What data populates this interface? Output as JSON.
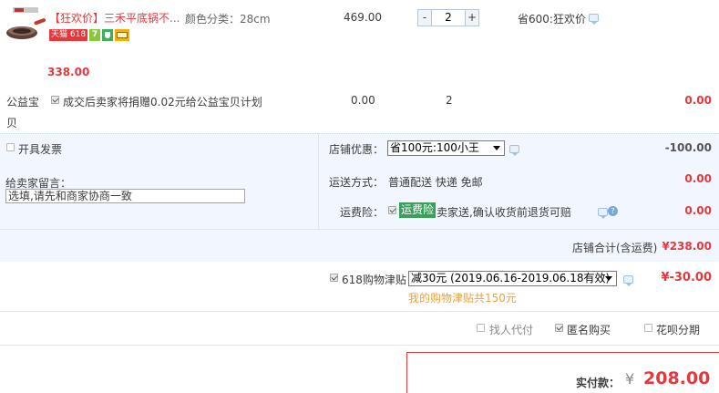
{
  "item": {
    "title_tag": "【狂欢价】",
    "title": "三禾平底锅不...",
    "badge_tmall": "天猫",
    "badge_618": "618",
    "badge_seven": "7",
    "sku_label": "颜色分类：",
    "sku_value": "28cm",
    "unit_price": "469.00",
    "qty": "2",
    "qty_minus": "-",
    "qty_plus": "+",
    "promo": "省600:狂欢价",
    "subtotal": "338.00"
  },
  "charity": {
    "label": "公益宝贝",
    "text": "成交后卖家将捐赠0.02元给公益宝贝计划",
    "price": "0.00",
    "qty": "2",
    "total": "0.00"
  },
  "invoice": {
    "label": "开具发票"
  },
  "seller_msg": {
    "label": "给卖家留言：",
    "value": "选填,请先和商家协商一致"
  },
  "shop_discount": {
    "label": "店铺优惠：",
    "selected": "省100元:100小王",
    "amount": "-100.00"
  },
  "shipping": {
    "label": "运送方式：",
    "value": "普通配送 快递 免邮",
    "amount": "0.00"
  },
  "insurance": {
    "label": "运费险：",
    "tag": "运费险",
    "text": "卖家送,确认收货前退货可赔",
    "amount": "0.00"
  },
  "shop_total": {
    "label": "店铺合计(含运费)",
    "value": "¥238.00"
  },
  "allowance": {
    "label": "618购物津贴",
    "selected": "减30元 (2019.06.16-2019.06.18有效)",
    "amount": "¥-30.00",
    "note": "我的购物津贴共150元"
  },
  "options": {
    "proxy_pay": "找人代付",
    "anonymous": "匿名购买",
    "installment": "花呗分期"
  },
  "pay": {
    "label": "实付款：",
    "currency": "¥",
    "amount": "208.00"
  },
  "colors": {
    "accent": "#e4393c",
    "row_bg": "#f2f7ff",
    "green": "#3c9e5b",
    "note": "#e8a33d"
  }
}
